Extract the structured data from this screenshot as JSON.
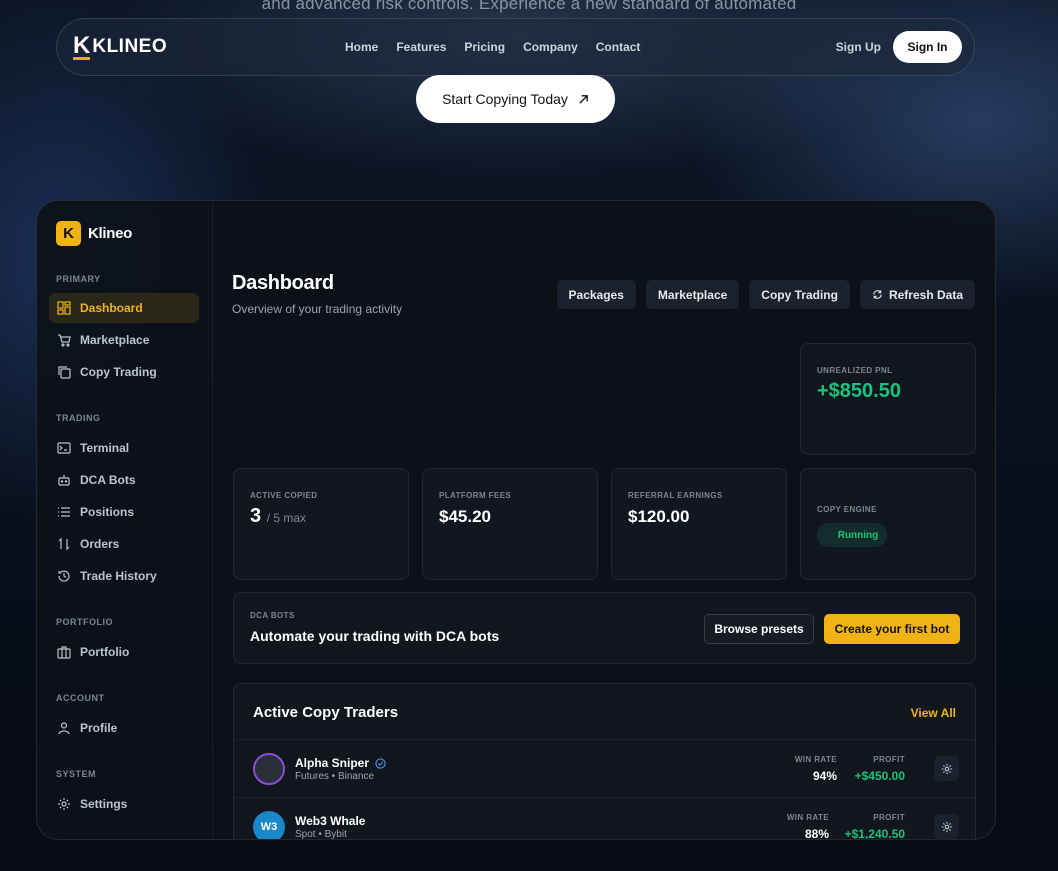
{
  "hero": {
    "text": "and advanced risk controls. Experience a new standard of automated",
    "cta_label": "Start Copying Today"
  },
  "navbar": {
    "logo_mark": "K",
    "logo_text": "KLINEO",
    "links": [
      "Home",
      "Features",
      "Pricing",
      "Company",
      "Contact"
    ],
    "signup": "Sign Up",
    "signin": "Sign In"
  },
  "sidebar": {
    "brand_mark": "K",
    "brand_name": "Klineo",
    "sections": [
      {
        "title": "PRIMARY",
        "items": [
          {
            "label": "Dashboard",
            "icon": "dashboard-icon",
            "active": true
          },
          {
            "label": "Marketplace",
            "icon": "cart-icon"
          },
          {
            "label": "Copy Trading",
            "icon": "copy-icon"
          }
        ]
      },
      {
        "title": "TRADING",
        "items": [
          {
            "label": "Terminal",
            "icon": "terminal-icon"
          },
          {
            "label": "DCA Bots",
            "icon": "bot-icon"
          },
          {
            "label": "Positions",
            "icon": "list-icon"
          },
          {
            "label": "Orders",
            "icon": "sort-icon"
          },
          {
            "label": "Trade History",
            "icon": "history-icon"
          }
        ]
      },
      {
        "title": "PORTFOLIO",
        "items": [
          {
            "label": "Portfolio",
            "icon": "briefcase-icon"
          }
        ]
      },
      {
        "title": "ACCOUNT",
        "items": [
          {
            "label": "Profile",
            "icon": "user-icon"
          }
        ]
      },
      {
        "title": "SYSTEM",
        "items": [
          {
            "label": "Settings",
            "icon": "gear-icon"
          }
        ]
      }
    ]
  },
  "header": {
    "title": "Dashboard",
    "subtitle": "Overview of your trading activity",
    "buttons": [
      "Packages",
      "Marketplace",
      "Copy Trading",
      "Refresh Data"
    ]
  },
  "stats": {
    "unrealized_pnl": {
      "label": "UNREALIZED PNL",
      "value": "+$850.50"
    },
    "active_copied": {
      "label": "ACTIVE COPIED",
      "value": "3",
      "sub": "/ 5 max"
    },
    "platform_fees": {
      "label": "PLATFORM FEES",
      "value": "$45.20"
    },
    "referral_earnings": {
      "label": "REFERRAL EARNINGS",
      "value": "$120.00"
    },
    "copy_engine": {
      "label": "COPY ENGINE",
      "status": "Running"
    }
  },
  "dca": {
    "label": "DCA BOTS",
    "title": "Automate your trading with DCA bots",
    "browse": "Browse presets",
    "create": "Create your first bot"
  },
  "traders": {
    "title": "Active Copy Traders",
    "view_all": "View All",
    "win_rate_label": "WIN RATE",
    "profit_label": "PROFIT",
    "rows": [
      {
        "name": "Alpha Sniper",
        "meta": "Futures • Binance",
        "win_rate": "94%",
        "profit": "+$450.00",
        "avatar": "",
        "verified": true
      },
      {
        "name": "Web3 Whale",
        "meta": "Spot • Bybit",
        "win_rate": "88%",
        "profit": "+$1,240.50",
        "avatar": "W3",
        "verified": false
      }
    ]
  },
  "colors": {
    "accent": "#f0b316",
    "positive": "#19c37d",
    "panel": "#0d1118"
  }
}
